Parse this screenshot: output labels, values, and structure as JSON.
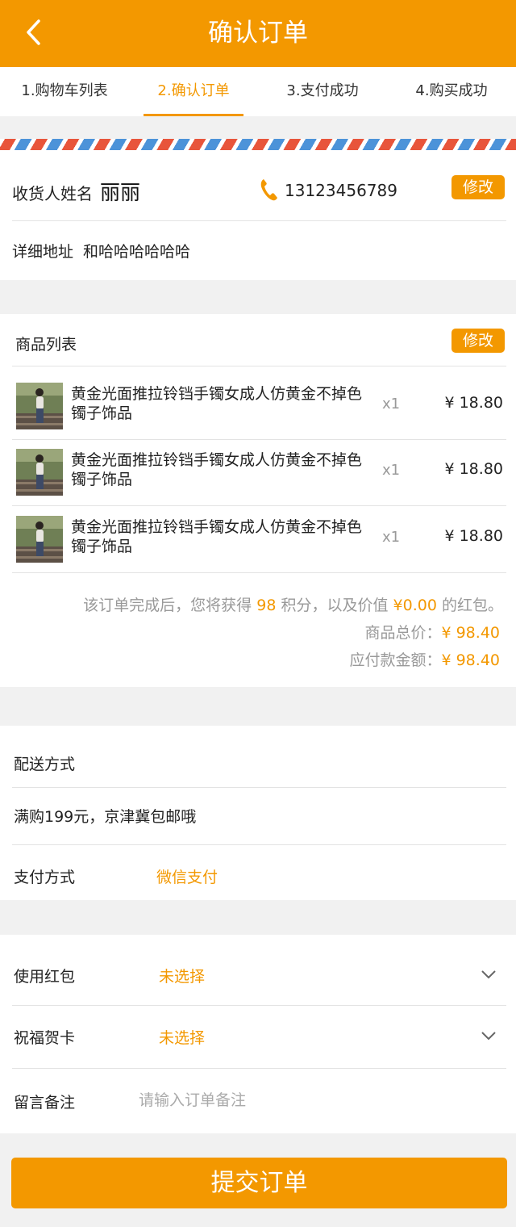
{
  "header": {
    "title": "确认订单",
    "back_icon": "chevron-left-icon"
  },
  "steps": [
    {
      "label": "1.购物车列表"
    },
    {
      "label": "2.确认订单",
      "active": true
    },
    {
      "label": "3.支付成功"
    },
    {
      "label": "4.购买成功"
    }
  ],
  "address": {
    "name_label": "收货人姓名",
    "name": "丽丽",
    "phone_icon": "phone-icon",
    "phone": "13123456789",
    "edit_label": "修改",
    "detail_label": "详细地址",
    "detail": "和哈哈哈哈哈哈"
  },
  "goods": {
    "title": "商品列表",
    "edit_label": "修改",
    "items": [
      {
        "name": "黄金光面推拉铃铛手镯女成人仿黄金不掉色镯子饰品",
        "qty": "x1",
        "price": "¥ 18.80"
      },
      {
        "name": "黄金光面推拉铃铛手镯女成人仿黄金不掉色镯子饰品",
        "qty": "x1",
        "price": "¥ 18.80"
      },
      {
        "name": "黄金光面推拉铃铛手镯女成人仿黄金不掉色镯子饰品",
        "qty": "x1",
        "price": "¥ 18.80"
      }
    ],
    "points_prefix": "该订单完成后，您将获得",
    "points": "98",
    "points_mid": "积分，以及价值",
    "redpacket_value": "¥0.00",
    "points_suffix": "的红包。",
    "subtotal_label": "商品总价：",
    "subtotal": "¥ 98.40",
    "payable_label": "应付款金额：",
    "payable": "¥ 98.40"
  },
  "shipping": {
    "label": "配送方式",
    "note": "满购199元，京津冀包邮哦",
    "payment_label": "支付方式",
    "payment_value": "微信支付"
  },
  "options": {
    "redpacket_label": "使用红包",
    "redpacket_value": "未选择",
    "card_label": "祝福贺卡",
    "card_value": "未选择",
    "remark_label": "留言备注",
    "remark_placeholder": "请输入订单备注",
    "remark_value": ""
  },
  "submit_label": "提交订单",
  "colors": {
    "accent": "#f39800",
    "stripe_red": "#e8553b",
    "stripe_blue": "#4c93d9"
  }
}
